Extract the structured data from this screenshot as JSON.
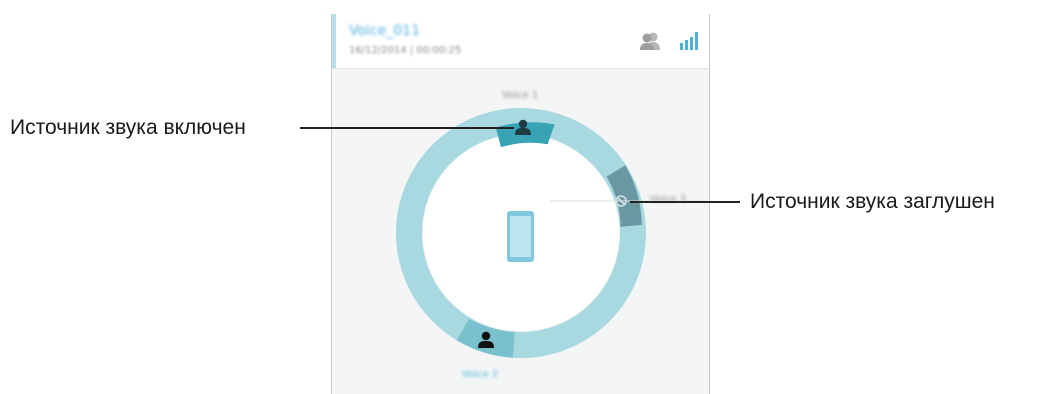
{
  "screen": {
    "header": {
      "file_name": "Voice_011",
      "file_meta": "16/12/2014 | 00:00:25",
      "icons": [
        "persons-icon",
        "level-bars-icon"
      ]
    },
    "speakers": {
      "top_label": "Voice 1",
      "right_label": "Voice 3",
      "bottom_label": "Voice 2"
    }
  },
  "annotations": {
    "active_source": "Источник звука включен",
    "muted_source": "Источник звука заглушен"
  },
  "colors": {
    "ring": "#a8d8e0",
    "active_segment": "#37a3b5",
    "muted_segment": "#6a97a1",
    "bottom_segment": "#78c1cd",
    "accent_text": "#52aee0"
  }
}
